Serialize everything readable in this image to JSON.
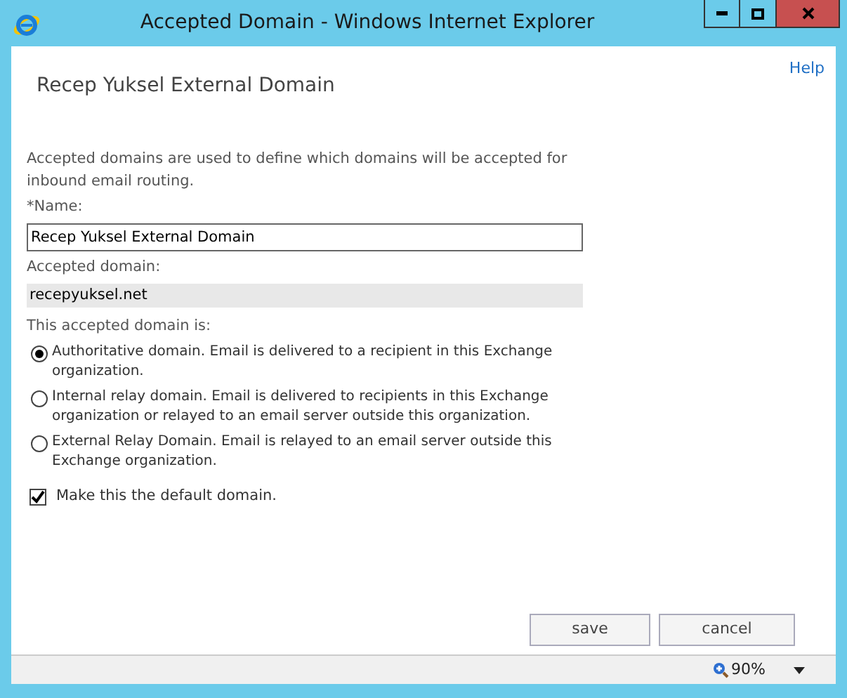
{
  "window": {
    "title": "Accepted Domain - Windows Internet Explorer"
  },
  "help_link": "Help",
  "heading": "Recep Yuksel External Domain",
  "description": "Accepted domains are used to define which domains will be accepted for inbound email routing.",
  "name_field": {
    "label": "*Name:",
    "value": "Recep Yuksel External Domain"
  },
  "domain_field": {
    "label": "Accepted domain:",
    "value": "recepyuksel.net"
  },
  "domain_type": {
    "label": "This accepted domain is:",
    "options": [
      {
        "label": "Authoritative domain. Email is delivered to a recipient in this Exchange organization.",
        "selected": true
      },
      {
        "label": "Internal relay domain. Email is delivered to recipients in this Exchange organization or relayed to an email server outside this organization.",
        "selected": false
      },
      {
        "label": "External Relay Domain. Email is relayed to an email server outside this Exchange organization.",
        "selected": false
      }
    ]
  },
  "default_domain": {
    "label": "Make this the default domain.",
    "checked": true
  },
  "buttons": [
    "save",
    "cancel"
  ],
  "status_bar": {
    "zoom": "90%"
  }
}
